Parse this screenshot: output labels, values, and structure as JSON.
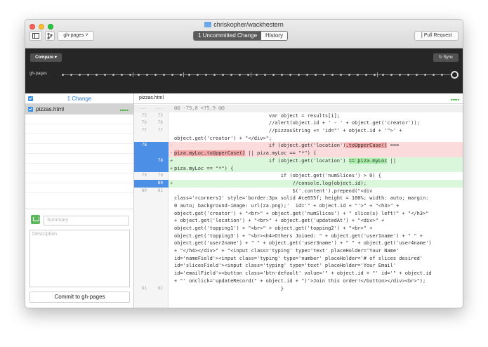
{
  "window": {
    "repo_title": "chriskopher/wackhestern"
  },
  "toolbar": {
    "branch_label": "gh-pages ˅",
    "uncommitted_label": "1 Uncommitted Change",
    "history_label": "History",
    "pull_request_label": "Pull Request"
  },
  "compare_bar": {
    "compare_label": "Compare ▾",
    "sync_label": "Sync",
    "branch_label": "gh-pages"
  },
  "sidebar": {
    "changes_count": "1 Change",
    "files": [
      {
        "name": "pizzas.html",
        "status": "modified"
      }
    ],
    "summary_placeholder": "Summary",
    "description_placeholder": "Description",
    "commit_label": "Commit to gh-pages"
  },
  "diff": {
    "filename": "pizzas.html",
    "hunk_header": "@@ -75,8 +75,9 @@",
    "lines": [
      {
        "type": "hunk",
        "old": "...",
        "new": "...",
        "text": "@@ -75,8 +75,9 @@"
      },
      {
        "type": "ctx",
        "old": "75",
        "new": "75",
        "text": "                                var object = results[i];"
      },
      {
        "type": "ctx",
        "old": "76",
        "new": "76",
        "text": "                                //alert(object.id + ' - ' + object.get('creator'));"
      },
      {
        "type": "ctx",
        "old": "77",
        "new": "77",
        "text": "                                //pizzasString += 'id=\"' + object.id + '\">' +"
      },
      {
        "type": "ctx",
        "old": "",
        "new": "",
        "text": "object.get('creator') + \"</div>\";"
      },
      {
        "type": "del",
        "old": "78",
        "new": "",
        "pre": "                                if (object.get('location')",
        "hl": ".toUpperCase()",
        "post": " ==="
      },
      {
        "type": "del",
        "old": "",
        "new": "",
        "pre": "",
        "hl": "piza.myLoc.toUpperCase()",
        "post": " || piza.myLoc == \"*\") {"
      },
      {
        "type": "add",
        "old": "",
        "new": "78",
        "pre": "                                if (object.get('location') ",
        "hl": "== piza.myLoc",
        "post": " ||"
      },
      {
        "type": "add",
        "old": "",
        "new": "",
        "pre": "piza.myLoc == \"*\") {",
        "hl": "",
        "post": ""
      },
      {
        "type": "ctx",
        "old": "79",
        "new": "79",
        "text": "                                    if (object.get('numSlices') > 0) {"
      },
      {
        "type": "add",
        "old": "",
        "new": "80",
        "pre": "                                        //console.log(object.id);",
        "hl": "",
        "post": ""
      },
      {
        "type": "ctx",
        "old": "80",
        "new": "81",
        "text": "                                        $('.content').prepend(\"<div"
      },
      {
        "type": "ctx",
        "old": "",
        "new": "",
        "text": "class='rcorners1' style='border:3px solid #ce655f; height = 100%; width: auto; margin:"
      },
      {
        "type": "ctx",
        "old": "",
        "new": "",
        "text": "0 auto; background-image: url(za.png);'  id='\" + object.id + \"'>\" + \"<h3>\" +"
      },
      {
        "type": "ctx",
        "old": "",
        "new": "",
        "text": "object.get('creator') + \"<br>\" + object.get('numSlices') + \" slice(s) left!\" + \"</h3>\""
      },
      {
        "type": "ctx",
        "old": "",
        "new": "",
        "text": "+ object.get('location') + \"<br>\" + object.get('updatedAt') + \"<div>\" +"
      },
      {
        "type": "ctx",
        "old": "",
        "new": "",
        "text": "object.get('topping1') + \"<br>\" + object.get('topping2') + \"<br>\" +"
      },
      {
        "type": "ctx",
        "old": "",
        "new": "",
        "text": "object.get('topping3') + \"<br><h4>Others Joined: \" + object.get('user1name') + \" \" +"
      },
      {
        "type": "ctx",
        "old": "",
        "new": "",
        "text": "object.get('user2name') + \" \" + object.get('user3name') + \" \" + object.get('user4name')"
      },
      {
        "type": "ctx",
        "old": "",
        "new": "",
        "text": "+ \"</h4></div>\" + \"<input class='typing' type='text' placeHolder='Your Name'"
      },
      {
        "type": "ctx",
        "old": "",
        "new": "",
        "text": "id='nameField'><input class='typing' type='number' placeHolder='# of slices desired'"
      },
      {
        "type": "ctx",
        "old": "",
        "new": "",
        "text": "id='slicesField'><input class='typing' type='text' placeHolder='Your Email'"
      },
      {
        "type": "ctx",
        "old": "",
        "new": "",
        "text": "id='emailField'><button class='btn-default' value='\" + object.id + \"' id='\" + object.id"
      },
      {
        "type": "ctx",
        "old": "",
        "new": "",
        "text": "+ \"' onclick='updateRecord(\" + object.id + \")'>Join this order!</button></div><br>\");"
      },
      {
        "type": "ctx",
        "old": "81",
        "new": "82",
        "text": "                                    }"
      }
    ]
  },
  "colors": {
    "accent": "#2f8ce8",
    "added": "#dbf7db",
    "removed": "#fbdbdb",
    "gutter_selected": "#4c8fe6"
  }
}
